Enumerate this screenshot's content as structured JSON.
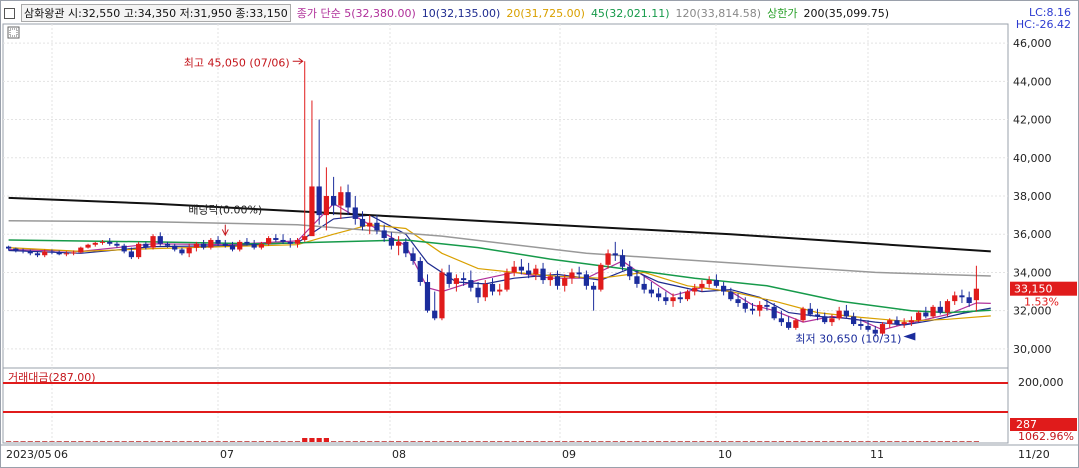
{
  "chart_data": {
    "type": "candlestick",
    "summary": "삼화왕관 시:32,550 고:34,350 저:31,950 종:33,150",
    "ma_legend": [
      "종가 단순 5(32,380.00)",
      "10(32,135.00)",
      "20(31,725.00)",
      "45(32,021.11)",
      "120(33,814.58)",
      "상한가",
      "200(35,099.75)"
    ],
    "lc_text": "LC:8.16",
    "hc_text": "HC:-26.42",
    "ylim": [
      29000,
      47000
    ],
    "yticks": [
      30000,
      32000,
      34000,
      36000,
      38000,
      40000,
      42000,
      44000,
      46000
    ],
    "ytick_labels": [
      "30,000",
      "32,000",
      "34,000",
      "36,000",
      "38,000",
      "40,000",
      "42,000",
      "44,000",
      "46,000"
    ],
    "x_tick_labels": [
      "2023/05",
      "06",
      "07",
      "08",
      "09",
      "10",
      "11",
      "11/20"
    ],
    "current_price_label": "33,150",
    "current_change_label": "1.53%",
    "current_price": 33150,
    "high_label": "최고 45,050 (07/06)",
    "low_label": "최저 30,650 (10/31)",
    "dividend_label": "배당락(0.00%)",
    "volume": {
      "label": "거래대금(287.00)",
      "tick_label": "200,000",
      "current_label": "287",
      "change_label": "1062.96%"
    },
    "ohlc": [
      [
        35350,
        35400,
        35150,
        35250
      ],
      [
        35250,
        35300,
        35050,
        35150
      ],
      [
        35150,
        35250,
        35000,
        35100
      ],
      [
        35100,
        35200,
        34900,
        35000
      ],
      [
        35000,
        35100,
        34800,
        34900
      ],
      [
        34900,
        35200,
        34800,
        35100
      ],
      [
        35100,
        35200,
        34950,
        35050
      ],
      [
        35050,
        35150,
        34900,
        34950
      ],
      [
        34950,
        35100,
        34850,
        35000
      ],
      [
        35000,
        35150,
        34900,
        35050
      ],
      [
        35050,
        35350,
        35000,
        35300
      ],
      [
        35300,
        35500,
        35250,
        35450
      ],
      [
        35450,
        35600,
        35350,
        35550
      ],
      [
        35550,
        35700,
        35450,
        35600
      ],
      [
        35600,
        35800,
        35400,
        35500
      ],
      [
        35500,
        35600,
        35300,
        35400
      ],
      [
        35400,
        35500,
        35000,
        35100
      ],
      [
        35100,
        35300,
        34700,
        34800
      ],
      [
        34800,
        35600,
        34700,
        35500
      ],
      [
        35500,
        35600,
        35200,
        35300
      ],
      [
        35300,
        36000,
        35200,
        35900
      ],
      [
        35900,
        36100,
        35400,
        35500
      ],
      [
        35500,
        35600,
        35300,
        35400
      ],
      [
        35400,
        35500,
        35100,
        35200
      ],
      [
        35200,
        35300,
        34900,
        35000
      ],
      [
        35000,
        35500,
        34800,
        35300
      ],
      [
        35300,
        35600,
        35100,
        35500
      ],
      [
        35500,
        35700,
        35200,
        35300
      ],
      [
        35300,
        35800,
        35200,
        35700
      ],
      [
        35700,
        35900,
        35400,
        35500
      ],
      [
        35500,
        35700,
        35300,
        35400
      ],
      [
        35400,
        35600,
        35100,
        35200
      ],
      [
        35200,
        35700,
        35100,
        35600
      ],
      [
        35600,
        35800,
        35400,
        35500
      ],
      [
        35500,
        35700,
        35200,
        35300
      ],
      [
        35300,
        35600,
        35200,
        35500
      ],
      [
        35500,
        35900,
        35400,
        35800
      ],
      [
        35800,
        36000,
        35600,
        35700
      ],
      [
        35700,
        36000,
        35500,
        35600
      ],
      [
        35600,
        35800,
        35300,
        35500
      ],
      [
        35500,
        35800,
        35300,
        35700
      ],
      [
        35700,
        45050,
        35600,
        35900
      ],
      [
        35900,
        43000,
        36000,
        38500
      ],
      [
        38500,
        42000,
        36500,
        37000
      ],
      [
        37000,
        39500,
        36200,
        38000
      ],
      [
        38000,
        39000,
        37000,
        37500
      ],
      [
        37500,
        38500,
        36800,
        38200
      ],
      [
        38200,
        38600,
        37000,
        37400
      ],
      [
        37400,
        38000,
        36500,
        36800
      ],
      [
        36800,
        37200,
        36200,
        36400
      ],
      [
        36400,
        37000,
        36000,
        36600
      ],
      [
        36600,
        37000,
        36000,
        36200
      ],
      [
        36200,
        36500,
        35600,
        35800
      ],
      [
        35800,
        36100,
        35200,
        35400
      ],
      [
        35400,
        35900,
        34900,
        35600
      ],
      [
        35600,
        35800,
        34800,
        35000
      ],
      [
        35000,
        35300,
        34400,
        34600
      ],
      [
        34600,
        34800,
        33300,
        33500
      ],
      [
        33500,
        33900,
        31900,
        32000
      ],
      [
        32000,
        33000,
        31500,
        31600
      ],
      [
        31600,
        34200,
        31500,
        34000
      ],
      [
        34000,
        34400,
        33200,
        33400
      ],
      [
        33400,
        33900,
        33000,
        33700
      ],
      [
        33700,
        34000,
        33300,
        33600
      ],
      [
        33600,
        34100,
        33000,
        33200
      ],
      [
        33200,
        33500,
        32400,
        32700
      ],
      [
        32700,
        33600,
        32500,
        33400
      ],
      [
        33400,
        33700,
        32800,
        33000
      ],
      [
        33000,
        33400,
        32800,
        33100
      ],
      [
        33100,
        34200,
        33000,
        34000
      ],
      [
        34000,
        34600,
        33800,
        34300
      ],
      [
        34300,
        34700,
        33900,
        34100
      ],
      [
        34100,
        34500,
        33700,
        33900
      ],
      [
        33900,
        34400,
        33600,
        34200
      ],
      [
        34200,
        34500,
        33400,
        33600
      ],
      [
        33600,
        34000,
        33300,
        33800
      ],
      [
        33800,
        34100,
        33100,
        33300
      ],
      [
        33300,
        33900,
        33000,
        33700
      ],
      [
        33700,
        34200,
        33400,
        34000
      ],
      [
        34000,
        34300,
        33700,
        33900
      ],
      [
        33900,
        34100,
        33100,
        33300
      ],
      [
        33300,
        33500,
        32000,
        33100
      ],
      [
        33100,
        34500,
        33000,
        34400
      ],
      [
        34400,
        35200,
        34200,
        35000
      ],
      [
        35000,
        35600,
        34600,
        34900
      ],
      [
        34900,
        35200,
        34100,
        34300
      ],
      [
        34300,
        34600,
        33600,
        33800
      ],
      [
        33800,
        34100,
        33200,
        33400
      ],
      [
        33400,
        33800,
        32900,
        33100
      ],
      [
        33100,
        33500,
        32700,
        32900
      ],
      [
        32900,
        33200,
        32500,
        32700
      ],
      [
        32700,
        33000,
        32300,
        32500
      ],
      [
        32500,
        32900,
        32200,
        32700
      ],
      [
        32700,
        33000,
        32400,
        32600
      ],
      [
        32600,
        33100,
        32500,
        33000
      ],
      [
        33000,
        33400,
        32800,
        33200
      ],
      [
        33200,
        33600,
        33000,
        33400
      ],
      [
        33400,
        33800,
        33200,
        33600
      ],
      [
        33600,
        33900,
        33200,
        33300
      ],
      [
        33300,
        33500,
        32800,
        33000
      ],
      [
        33000,
        33200,
        32500,
        32600
      ],
      [
        32600,
        32900,
        32200,
        32400
      ],
      [
        32400,
        32700,
        31900,
        32100
      ],
      [
        32100,
        32400,
        31800,
        32000
      ],
      [
        32000,
        32500,
        31700,
        32300
      ],
      [
        32300,
        32600,
        32000,
        32200
      ],
      [
        32200,
        32400,
        31500,
        31600
      ],
      [
        31600,
        32000,
        31200,
        31400
      ],
      [
        31400,
        31700,
        31000,
        31100
      ],
      [
        31100,
        31600,
        31000,
        31500
      ],
      [
        31500,
        32200,
        31400,
        32100
      ],
      [
        32100,
        32400,
        31700,
        31800
      ],
      [
        31800,
        32100,
        31500,
        31700
      ],
      [
        31700,
        31900,
        31300,
        31400
      ],
      [
        31400,
        31800,
        31200,
        31600
      ],
      [
        31600,
        32200,
        31500,
        32000
      ],
      [
        32000,
        32300,
        31600,
        31700
      ],
      [
        31700,
        31900,
        31200,
        31300
      ],
      [
        31300,
        31600,
        31000,
        31200
      ],
      [
        31200,
        31500,
        30900,
        31000
      ],
      [
        31000,
        31200,
        30650,
        30800
      ],
      [
        30800,
        31400,
        30700,
        31300
      ],
      [
        31300,
        31600,
        31100,
        31500
      ],
      [
        31500,
        31700,
        31200,
        31300
      ],
      [
        31300,
        31600,
        31100,
        31400
      ],
      [
        31400,
        31700,
        31200,
        31500
      ],
      [
        31500,
        32000,
        31400,
        31900
      ],
      [
        31900,
        32200,
        31600,
        31700
      ],
      [
        31700,
        32300,
        31600,
        32200
      ],
      [
        32200,
        32500,
        31800,
        31900
      ],
      [
        31900,
        32600,
        31700,
        32500
      ],
      [
        32500,
        33000,
        32300,
        32800
      ],
      [
        32800,
        33100,
        32400,
        32700
      ],
      [
        32700,
        33000,
        32200,
        32400
      ],
      [
        32550,
        34350,
        31950,
        33150
      ]
    ],
    "ma": [
      {
        "name": "5",
        "color": "#b0309a",
        "width": 1.2,
        "points": [
          [
            0,
            35200
          ],
          [
            10,
            35100
          ],
          [
            20,
            35500
          ],
          [
            30,
            35450
          ],
          [
            40,
            35650
          ],
          [
            45,
            37600
          ],
          [
            50,
            36500
          ],
          [
            55,
            35400
          ],
          [
            58,
            33200
          ],
          [
            60,
            33000
          ],
          [
            65,
            33600
          ],
          [
            70,
            34000
          ],
          [
            75,
            33700
          ],
          [
            80,
            33700
          ],
          [
            85,
            34600
          ],
          [
            88,
            33800
          ],
          [
            92,
            32800
          ],
          [
            96,
            33200
          ],
          [
            100,
            33000
          ],
          [
            103,
            32300
          ],
          [
            106,
            32000
          ],
          [
            110,
            31400
          ],
          [
            114,
            31700
          ],
          [
            118,
            31500
          ],
          [
            121,
            31000
          ],
          [
            123,
            31200
          ],
          [
            126,
            31450
          ],
          [
            130,
            31800
          ],
          [
            134,
            32400
          ],
          [
            136,
            32380
          ]
        ]
      },
      {
        "name": "10",
        "color": "#1e2b8f",
        "width": 1.2,
        "points": [
          [
            0,
            35150
          ],
          [
            10,
            35000
          ],
          [
            20,
            35350
          ],
          [
            30,
            35400
          ],
          [
            40,
            35550
          ],
          [
            45,
            36800
          ],
          [
            50,
            37000
          ],
          [
            55,
            36000
          ],
          [
            58,
            34500
          ],
          [
            62,
            33500
          ],
          [
            66,
            33400
          ],
          [
            70,
            33700
          ],
          [
            76,
            33900
          ],
          [
            82,
            33600
          ],
          [
            86,
            34200
          ],
          [
            90,
            33500
          ],
          [
            96,
            33000
          ],
          [
            100,
            33100
          ],
          [
            104,
            32700
          ],
          [
            108,
            31900
          ],
          [
            112,
            31700
          ],
          [
            116,
            31600
          ],
          [
            120,
            31400
          ],
          [
            124,
            31250
          ],
          [
            128,
            31500
          ],
          [
            132,
            31850
          ],
          [
            136,
            32135
          ]
        ]
      },
      {
        "name": "20",
        "color": "#d9a000",
        "width": 1.2,
        "points": [
          [
            0,
            35300
          ],
          [
            10,
            35100
          ],
          [
            20,
            35250
          ],
          [
            30,
            35350
          ],
          [
            40,
            35450
          ],
          [
            45,
            36000
          ],
          [
            50,
            36500
          ],
          [
            55,
            36300
          ],
          [
            60,
            35000
          ],
          [
            65,
            34200
          ],
          [
            70,
            34000
          ],
          [
            76,
            33800
          ],
          [
            82,
            33700
          ],
          [
            88,
            34000
          ],
          [
            94,
            33300
          ],
          [
            100,
            33000
          ],
          [
            106,
            32500
          ],
          [
            112,
            31900
          ],
          [
            118,
            31650
          ],
          [
            124,
            31450
          ],
          [
            130,
            31550
          ],
          [
            136,
            31725
          ]
        ]
      },
      {
        "name": "45",
        "color": "#169a4a",
        "width": 1.5,
        "points": [
          [
            0,
            35700
          ],
          [
            20,
            35600
          ],
          [
            35,
            35500
          ],
          [
            45,
            35600
          ],
          [
            55,
            35700
          ],
          [
            65,
            35300
          ],
          [
            75,
            34700
          ],
          [
            85,
            34200
          ],
          [
            95,
            33700
          ],
          [
            105,
            33300
          ],
          [
            115,
            32500
          ],
          [
            125,
            32000
          ],
          [
            130,
            31900
          ],
          [
            136,
            32021
          ]
        ]
      },
      {
        "name": "120",
        "color": "#999999",
        "width": 1.5,
        "points": [
          [
            0,
            36700
          ],
          [
            20,
            36650
          ],
          [
            40,
            36500
          ],
          [
            60,
            35900
          ],
          [
            80,
            35000
          ],
          [
            100,
            34500
          ],
          [
            120,
            34000
          ],
          [
            136,
            33815
          ]
        ]
      },
      {
        "name": "200",
        "color": "#111111",
        "width": 2,
        "points": [
          [
            0,
            37900
          ],
          [
            20,
            37600
          ],
          [
            40,
            37200
          ],
          [
            60,
            36800
          ],
          [
            80,
            36400
          ],
          [
            100,
            36000
          ],
          [
            120,
            35500
          ],
          [
            136,
            35100
          ]
        ]
      }
    ]
  }
}
